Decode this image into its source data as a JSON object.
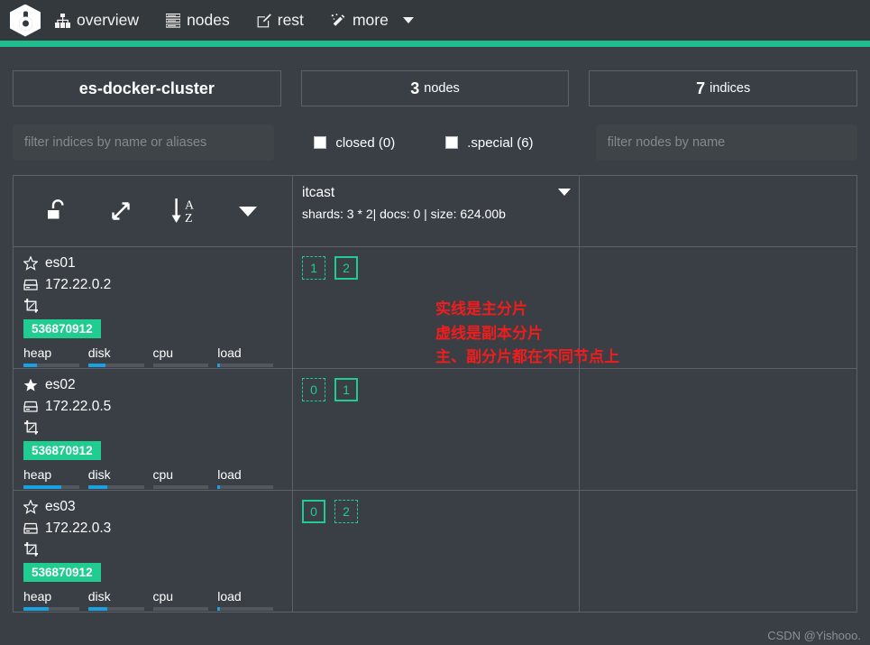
{
  "navbar": {
    "logo_icon": "cerebro-logo-icon",
    "items": [
      {
        "label": "overview",
        "icon": "sitemap-icon"
      },
      {
        "label": "nodes",
        "icon": "list-icon"
      },
      {
        "label": "rest",
        "icon": "edit-square-icon"
      },
      {
        "label": "more",
        "icon": "magic-wand-icon",
        "caret": true
      }
    ],
    "accent_color": "#1fbd8c",
    "background_color": "#34393d"
  },
  "summary": {
    "cluster_name": "es-docker-cluster",
    "nodes_count": "3",
    "nodes_label": "nodes",
    "indices_count": "7",
    "indices_label": "indices"
  },
  "filters": {
    "indices_placeholder": "filter indices by name or aliases",
    "indices_value": "",
    "nodes_placeholder": "filter nodes by name",
    "nodes_value": "",
    "checkboxes": [
      {
        "label": "closed (0)",
        "checked": false
      },
      {
        "label": ".special (6)",
        "checked": false
      }
    ]
  },
  "toolbar": {
    "icons": [
      {
        "name": "unlock-icon"
      },
      {
        "name": "expand-arrows-icon"
      },
      {
        "name": "sort-alpha-asc-icon"
      },
      {
        "name": "caret-down-icon"
      }
    ]
  },
  "index": {
    "name": "itcast",
    "meta": "shards: 3 * 2| docs: 0 | size: 624.00b"
  },
  "nodes": [
    {
      "name": "es01",
      "master": false,
      "star_icon": "star-outline-icon",
      "ip": "172.22.0.2",
      "ip_icon": "server-icon",
      "crop_icon": "crop-icon",
      "heap_bytes": "536870912",
      "metrics": [
        {
          "label": "heap",
          "pct": 25
        },
        {
          "label": "disk",
          "pct": 31
        },
        {
          "label": "cpu",
          "pct": 0
        },
        {
          "label": "load",
          "pct": 4
        }
      ],
      "shards": [
        {
          "num": "1",
          "type": "replica"
        },
        {
          "num": "2",
          "type": "primary"
        }
      ]
    },
    {
      "name": "es02",
      "master": true,
      "star_icon": "star-filled-icon",
      "ip": "172.22.0.5",
      "ip_icon": "server-icon",
      "crop_icon": "crop-icon",
      "heap_bytes": "536870912",
      "metrics": [
        {
          "label": "heap",
          "pct": 68
        },
        {
          "label": "disk",
          "pct": 35
        },
        {
          "label": "cpu",
          "pct": 0
        },
        {
          "label": "load",
          "pct": 4
        }
      ],
      "shards": [
        {
          "num": "0",
          "type": "replica"
        },
        {
          "num": "1",
          "type": "primary"
        }
      ]
    },
    {
      "name": "es03",
      "master": false,
      "star_icon": "star-outline-icon",
      "ip": "172.22.0.3",
      "ip_icon": "server-icon",
      "crop_icon": "crop-icon",
      "heap_bytes": "536870912",
      "metrics": [
        {
          "label": "heap",
          "pct": 45
        },
        {
          "label": "disk",
          "pct": 35
        },
        {
          "label": "cpu",
          "pct": 0
        },
        {
          "label": "load",
          "pct": 4
        }
      ],
      "shards": [
        {
          "num": "0",
          "type": "primary"
        },
        {
          "num": "2",
          "type": "replica"
        }
      ]
    }
  ],
  "annotation": {
    "text": "实线是主分片\n虚线是副本分片\n主、副分片都在不同节点上",
    "color": "#ef1d1d"
  },
  "watermark": "CSDN @Yishooo."
}
